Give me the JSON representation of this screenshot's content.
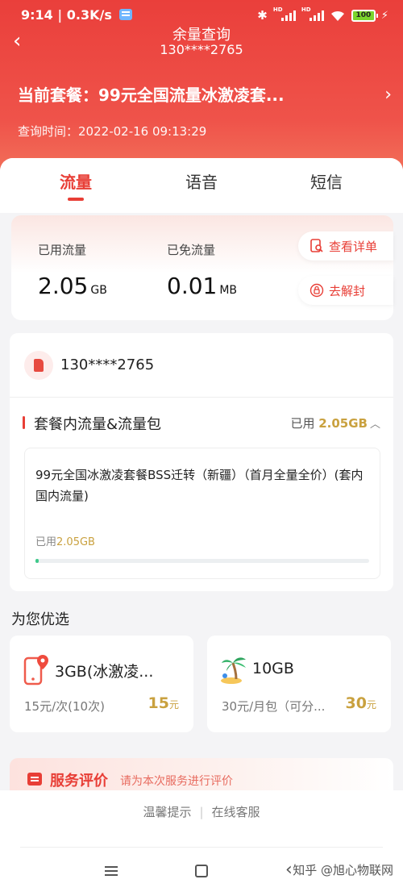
{
  "status_bar": {
    "time": "9:14",
    "speed": "0.3K/s",
    "battery": "100",
    "notification_icon": "message-app-icon",
    "bluetooth_icon": "bluetooth-icon"
  },
  "header": {
    "title": "余量查询",
    "subtitle": "130****2765",
    "plan_prefix": "当前套餐：",
    "plan_name": "99元全国流量冰激凌套...",
    "query_label": "查询时间：",
    "query_time": "2022-02-16 09:13:29"
  },
  "tabs": [
    {
      "label": "流量",
      "active": true
    },
    {
      "label": "语音",
      "active": false
    },
    {
      "label": "短信",
      "active": false
    }
  ],
  "usage": {
    "used_label": "已用流量",
    "used_value": "2.05",
    "used_unit": "GB",
    "free_label": "已免流量",
    "free_value": "0.01",
    "free_unit": "MB",
    "detail_button": "查看详单",
    "unblock_button": "去解封"
  },
  "detail": {
    "number": "130****2765",
    "section_title": "套餐内流量&流量包",
    "section_used_prefix": "已用 ",
    "section_used_value": "2.05GB",
    "plan_full_name": "99元全国冰激凌套餐BSS迁转（新疆）（首月全量全价）(套内国内流量)",
    "inner_used_prefix": "已用",
    "inner_used_value": "2.05GB",
    "progress_fraction": 0.01
  },
  "recommend": {
    "title": "为您优选",
    "offers": [
      {
        "name": "3GB(冰激凌...",
        "desc": "15元/次(10次)",
        "price": "15",
        "unit": "元",
        "icon": "phone-location-icon"
      },
      {
        "name": "10GB",
        "desc": "30元/月包（可分...",
        "price": "30",
        "unit": "元",
        "icon": "palm-tree-icon"
      }
    ]
  },
  "service": {
    "title": "服务评价",
    "subtitle": "请为本次服务进行评价"
  },
  "footer": {
    "tips": "温馨提示",
    "divider": "|",
    "online_service": "在线客服",
    "watermark": "知乎 @旭心物联网"
  },
  "colors": {
    "brand_red": "#e83e36",
    "gold": "#c9a13f",
    "progress_green": "#3ec98a"
  }
}
